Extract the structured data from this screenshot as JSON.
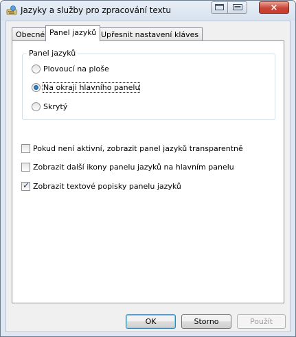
{
  "window": {
    "title": "Jazyky a služby pro zpracování textu",
    "icons": {
      "app": "keyboard-globe-icon",
      "maximize": "restore-window-icon",
      "help": "help-window-icon",
      "close": "close-icon"
    },
    "close_glyph": "×"
  },
  "tabs": [
    {
      "label": "Obecné",
      "active": false
    },
    {
      "label": "Panel jazyků",
      "active": true
    },
    {
      "label": "Upřesnit nastavení kláves",
      "active": false
    }
  ],
  "group": {
    "label": "Panel jazyků",
    "options": [
      {
        "label": "Plovoucí na ploše",
        "checked": false
      },
      {
        "label": "Na okraji hlavního panelu",
        "checked": true
      },
      {
        "label": "Skrytý",
        "checked": false
      }
    ]
  },
  "checkboxes": [
    {
      "label": "Pokud není aktivní, zobrazit panel jazyků transparentně",
      "checked": false
    },
    {
      "label": "Zobrazit další ikony panelu jazyků na hlavním panelu",
      "checked": false
    },
    {
      "label": "Zobrazit textové popisky panelu jazyků",
      "checked": true
    }
  ],
  "check_glyph": "✓",
  "buttons": {
    "ok": "OK",
    "cancel": "Storno",
    "apply": "Použít"
  },
  "colors": {
    "title_bar": "#dfe8f2",
    "close_button": "#c8473a",
    "radio_dot": "#1a5aa0"
  }
}
